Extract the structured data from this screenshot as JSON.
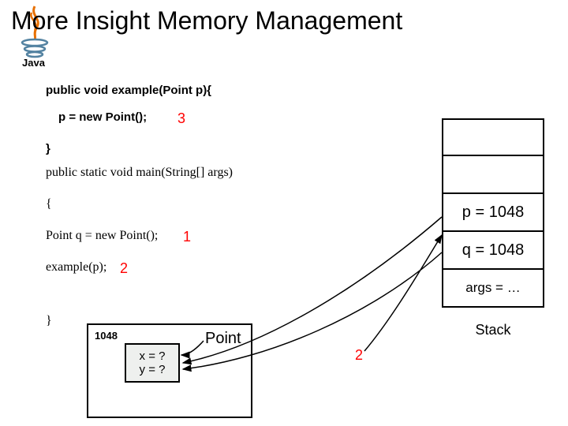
{
  "title": "More Insight Memory Management",
  "logo_text": "Java",
  "code": {
    "l1": "public void example(Point p){",
    "l2": "p = new Point();",
    "l3": "}",
    "l4": "public static void main(String[] args)",
    "l5": "{",
    "l6": "Point q = new Point();",
    "l7": "example(p);",
    "l8": "}"
  },
  "steps": {
    "s1": "1",
    "s2": "2",
    "s3": "3",
    "s2b": "2"
  },
  "stack": {
    "f0": "",
    "f1": "",
    "f2": "p = 1048",
    "f3": "q = 1048",
    "f4": "args = …",
    "label": "Stack"
  },
  "heap": {
    "addr": "1048",
    "obj_label": "Point",
    "fields": {
      "x": "x = ?",
      "y": "y = ?"
    }
  }
}
